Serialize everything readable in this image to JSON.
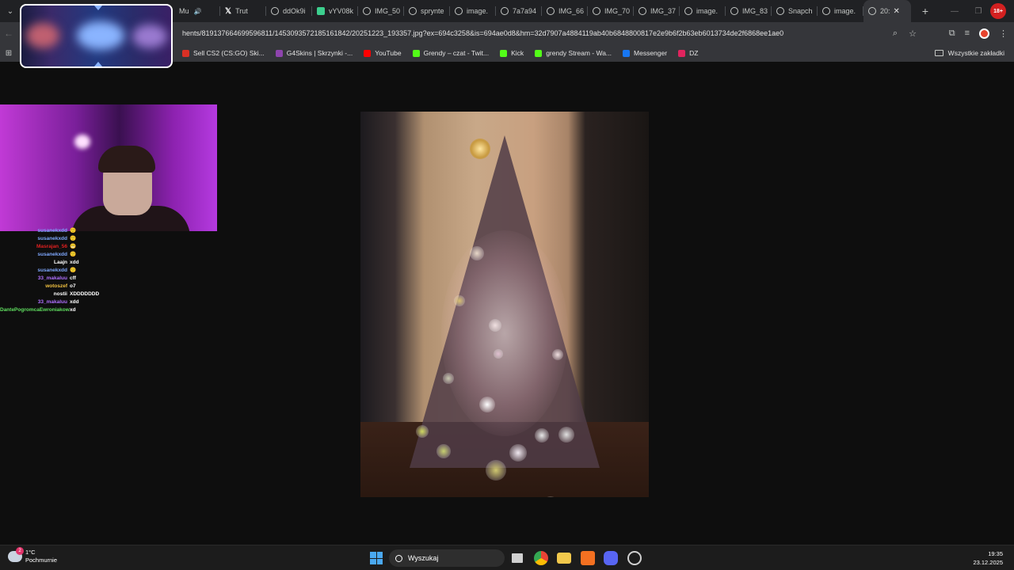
{
  "browser": {
    "tabs": [
      {
        "label": "Mu",
        "icon": "speaker-icon",
        "active": false
      },
      {
        "label": "Trut",
        "icon": "x-logo-icon",
        "active": false
      },
      {
        "label": "ddOk9i",
        "icon": "globe-icon",
        "active": false
      },
      {
        "label": "vYV08k",
        "icon": "app-icon",
        "active": false
      },
      {
        "label": "IMG_50",
        "icon": "globe-icon",
        "active": false
      },
      {
        "label": "sprynte",
        "icon": "globe-icon",
        "active": false
      },
      {
        "label": "image.",
        "icon": "globe-icon",
        "active": false
      },
      {
        "label": "7a7a94",
        "icon": "globe-icon",
        "active": false
      },
      {
        "label": "IMG_66",
        "icon": "globe-icon",
        "active": false
      },
      {
        "label": "IMG_70",
        "icon": "globe-icon",
        "active": false
      },
      {
        "label": "IMG_37",
        "icon": "globe-icon",
        "active": false
      },
      {
        "label": "image.",
        "icon": "globe-icon",
        "active": false
      },
      {
        "label": "IMG_83",
        "icon": "globe-icon",
        "active": false
      },
      {
        "label": "Snapch",
        "icon": "globe-icon",
        "active": false
      },
      {
        "label": "image.",
        "icon": "globe-icon",
        "active": false
      },
      {
        "label": "20:",
        "icon": "globe-icon",
        "active": true
      }
    ],
    "profile_badge": "18+",
    "url": "hents/819137664699596811/1453093572185161842/20251223_193357.jpg?ex=694c3258&is=694ae0d8&hm=32d7907a4884119ab40b6848800817e2e9b6f2b63eb6013734de2f6868ee1ae0",
    "bookmarks": [
      {
        "label": "Sell CS2 (CS:GO) Ski...",
        "color": "#d93025"
      },
      {
        "label": "G4Skins | Skrzynki -...",
        "color": "#8e44ad"
      },
      {
        "label": "YouTube",
        "color": "#ff0000"
      },
      {
        "label": "Grendy – czat - Twit...",
        "color": "#53fc18"
      },
      {
        "label": "Kick",
        "color": "#53fc18"
      },
      {
        "label": "grendy Stream - Wa...",
        "color": "#53fc18"
      },
      {
        "label": "Messenger",
        "color": "#1877f2"
      },
      {
        "label": "DZ",
        "color": "#e0245e"
      }
    ],
    "all_bookmarks_label": "Wszystkie zakładki"
  },
  "chat": [
    {
      "user": "susanekxdd",
      "msg": "🙂",
      "color": "#7fa8ff"
    },
    {
      "user": "susanekxdd",
      "msg": "🙂",
      "color": "#7fa8ff"
    },
    {
      "user": "Masrajan_56",
      "msg": "😬",
      "color": "#e02020"
    },
    {
      "user": "susanekxdd",
      "msg": "🙂",
      "color": "#7fa8ff"
    },
    {
      "user": "Laajn",
      "msg": "xdd",
      "color": "#ffffff"
    },
    {
      "user": "susanekxdd",
      "msg": "🙂",
      "color": "#7fa8ff"
    },
    {
      "user": "33_makaluu",
      "msg": "cff",
      "color": "#b070ff"
    },
    {
      "user": "wotoszef",
      "msg": "o7",
      "color": "#f0c040"
    },
    {
      "user": "nostii",
      "msg": "XDDDDDDD",
      "color": "#ffffff"
    },
    {
      "user": "33_makaluu",
      "msg": "xdd",
      "color": "#b070ff"
    },
    {
      "user": "DantePogromcaEwroniakow",
      "msg": "xd",
      "color": "#60e060"
    }
  ],
  "taskbar": {
    "weather_temp": "1°C",
    "weather_desc": "Pochmurnie",
    "weather_badge": "2",
    "search_label": "Wyszukaj",
    "time": "19:35",
    "date": "23.12.2025"
  }
}
